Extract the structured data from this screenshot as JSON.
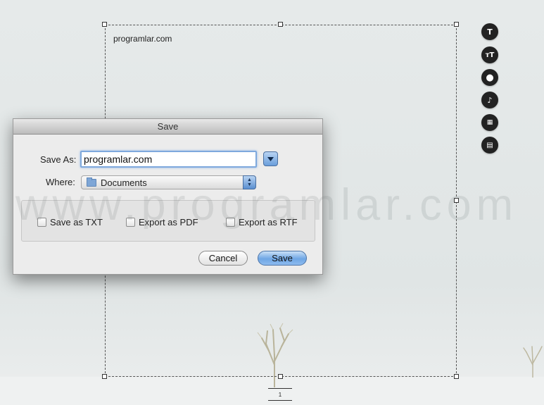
{
  "document": {
    "text": "programlar.com",
    "page_number": "1"
  },
  "watermark": "www.programlar.com",
  "toolbar": {
    "items": [
      {
        "icon": "text-icon",
        "glyph": "T"
      },
      {
        "icon": "text-size-icon",
        "glyph": "ᴛT"
      },
      {
        "icon": "record-icon",
        "glyph": "●"
      },
      {
        "icon": "music-note-icon",
        "glyph": "♪"
      },
      {
        "icon": "grid-icon",
        "glyph": "▦"
      },
      {
        "icon": "document-icon",
        "glyph": "▤"
      }
    ]
  },
  "dialog": {
    "title": "Save",
    "save_as_label": "Save As:",
    "save_as_value": "programlar.com",
    "where_label": "Where:",
    "where_value": "Documents",
    "options": [
      {
        "label": "Save as TXT",
        "checked": false
      },
      {
        "label": "Export as PDF",
        "checked": false
      },
      {
        "label": "Export as RTF",
        "checked": false
      }
    ],
    "cancel_label": "Cancel",
    "save_label": "Save"
  },
  "colors": {
    "background": "#e3e7e7",
    "accent": "#6fa6e4",
    "toolbar_button": "#222222"
  }
}
